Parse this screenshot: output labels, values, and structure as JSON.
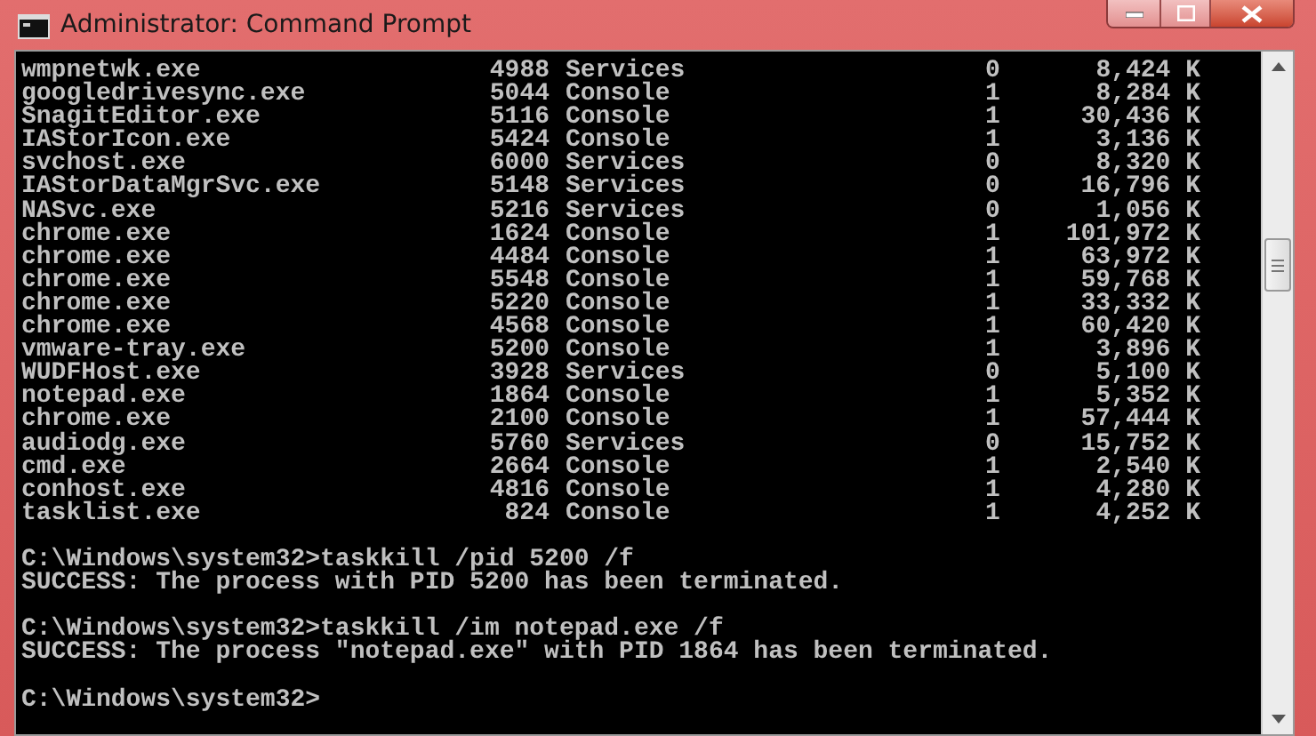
{
  "window": {
    "title": "Administrator: Command Prompt"
  },
  "rows": [
    {
      "name": "wmpnetwk.exe",
      "pid": "4988",
      "session_name": "Services",
      "session_number": "0",
      "mem_usage": "8,424 K"
    },
    {
      "name": "googledrivesync.exe",
      "pid": "5044",
      "session_name": "Console",
      "session_number": "1",
      "mem_usage": "8,284 K"
    },
    {
      "name": "SnagitEditor.exe",
      "pid": "5116",
      "session_name": "Console",
      "session_number": "1",
      "mem_usage": "30,436 K"
    },
    {
      "name": "IAStorIcon.exe",
      "pid": "5424",
      "session_name": "Console",
      "session_number": "1",
      "mem_usage": "3,136 K"
    },
    {
      "name": "svchost.exe",
      "pid": "6000",
      "session_name": "Services",
      "session_number": "0",
      "mem_usage": "8,320 K"
    },
    {
      "name": "IAStorDataMgrSvc.exe",
      "pid": "5148",
      "session_name": "Services",
      "session_number": "0",
      "mem_usage": "16,796 K"
    },
    {
      "name": "NASvc.exe",
      "pid": "5216",
      "session_name": "Services",
      "session_number": "0",
      "mem_usage": "1,056 K"
    },
    {
      "name": "chrome.exe",
      "pid": "1624",
      "session_name": "Console",
      "session_number": "1",
      "mem_usage": "101,972 K"
    },
    {
      "name": "chrome.exe",
      "pid": "4484",
      "session_name": "Console",
      "session_number": "1",
      "mem_usage": "63,972 K"
    },
    {
      "name": "chrome.exe",
      "pid": "5548",
      "session_name": "Console",
      "session_number": "1",
      "mem_usage": "59,768 K"
    },
    {
      "name": "chrome.exe",
      "pid": "5220",
      "session_name": "Console",
      "session_number": "1",
      "mem_usage": "33,332 K"
    },
    {
      "name": "chrome.exe",
      "pid": "4568",
      "session_name": "Console",
      "session_number": "1",
      "mem_usage": "60,420 K"
    },
    {
      "name": "vmware-tray.exe",
      "pid": "5200",
      "session_name": "Console",
      "session_number": "1",
      "mem_usage": "3,896 K"
    },
    {
      "name": "WUDFHost.exe",
      "pid": "3928",
      "session_name": "Services",
      "session_number": "0",
      "mem_usage": "5,100 K"
    },
    {
      "name": "notepad.exe",
      "pid": "1864",
      "session_name": "Console",
      "session_number": "1",
      "mem_usage": "5,352 K"
    },
    {
      "name": "chrome.exe",
      "pid": "2100",
      "session_name": "Console",
      "session_number": "1",
      "mem_usage": "57,444 K"
    },
    {
      "name": "audiodg.exe",
      "pid": "5760",
      "session_name": "Services",
      "session_number": "0",
      "mem_usage": "15,752 K"
    },
    {
      "name": "cmd.exe",
      "pid": "2664",
      "session_name": "Console",
      "session_number": "1",
      "mem_usage": "2,540 K"
    },
    {
      "name": "conhost.exe",
      "pid": "4816",
      "session_name": "Console",
      "session_number": "1",
      "mem_usage": "4,280 K"
    },
    {
      "name": "tasklist.exe",
      "pid": "824",
      "session_name": "Console",
      "session_number": "1",
      "mem_usage": "4,252 K"
    }
  ],
  "console_lines": [
    {
      "kind": "command",
      "text": "C:\\Windows\\system32>taskkill /pid 5200 /f"
    },
    {
      "kind": "output",
      "text": "SUCCESS: The process with PID 5200 has been terminated."
    },
    {
      "kind": "command",
      "text": "C:\\Windows\\system32>taskkill /im notepad.exe /f"
    },
    {
      "kind": "output",
      "text": "SUCCESS: The process \"notepad.exe\" with PID 1864 has been terminated."
    },
    {
      "kind": "command",
      "text": "C:\\Windows\\system32>"
    }
  ]
}
